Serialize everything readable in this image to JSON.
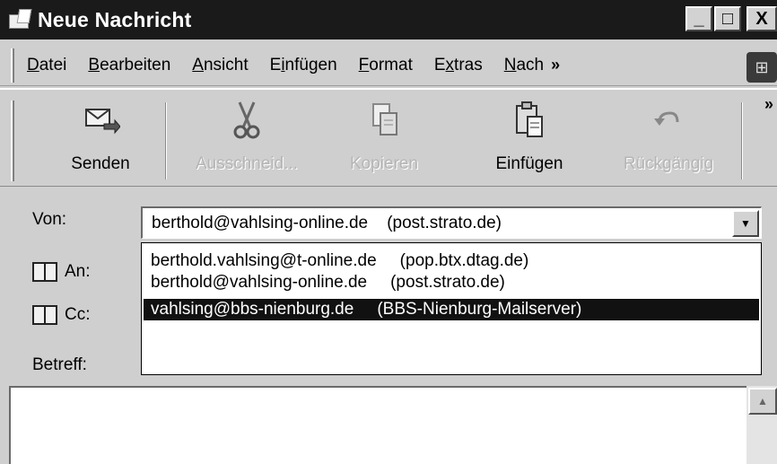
{
  "window": {
    "title": "Neue Nachricht",
    "min": "_",
    "max": "□",
    "close": "X"
  },
  "menu": {
    "items": [
      {
        "pre": "",
        "acc": "D",
        "post": "atei"
      },
      {
        "pre": "",
        "acc": "B",
        "post": "earbeiten"
      },
      {
        "pre": "",
        "acc": "A",
        "post": "nsicht"
      },
      {
        "pre": "E",
        "acc": "i",
        "post": "nfügen"
      },
      {
        "pre": "",
        "acc": "F",
        "post": "ormat"
      },
      {
        "pre": "E",
        "acc": "x",
        "post": "tras"
      },
      {
        "pre": "",
        "acc": "N",
        "post": "ach"
      }
    ],
    "more": "»"
  },
  "toolbar": {
    "send": "Senden",
    "cut": "Ausschneid...",
    "copy": "Kopieren",
    "paste": "Einfügen",
    "undo": "Rückgängig",
    "more": "»"
  },
  "header": {
    "from_label": "Von:",
    "to_label": "An:",
    "cc_label": "Cc:",
    "subject_label": "Betreff:",
    "from_value": "berthold@vahlsing-online.de    (post.strato.de)",
    "accounts": [
      {
        "addr": "berthold.vahlsing@t-online.de",
        "server": "(pop.btx.dtag.de)"
      },
      {
        "addr": "berthold@vahlsing-online.de",
        "server": "(post.strato.de)"
      },
      {
        "addr": "vahlsing@bbs-nienburg.de",
        "server": "(BBS-Nienburg-Mailserver)"
      }
    ]
  }
}
